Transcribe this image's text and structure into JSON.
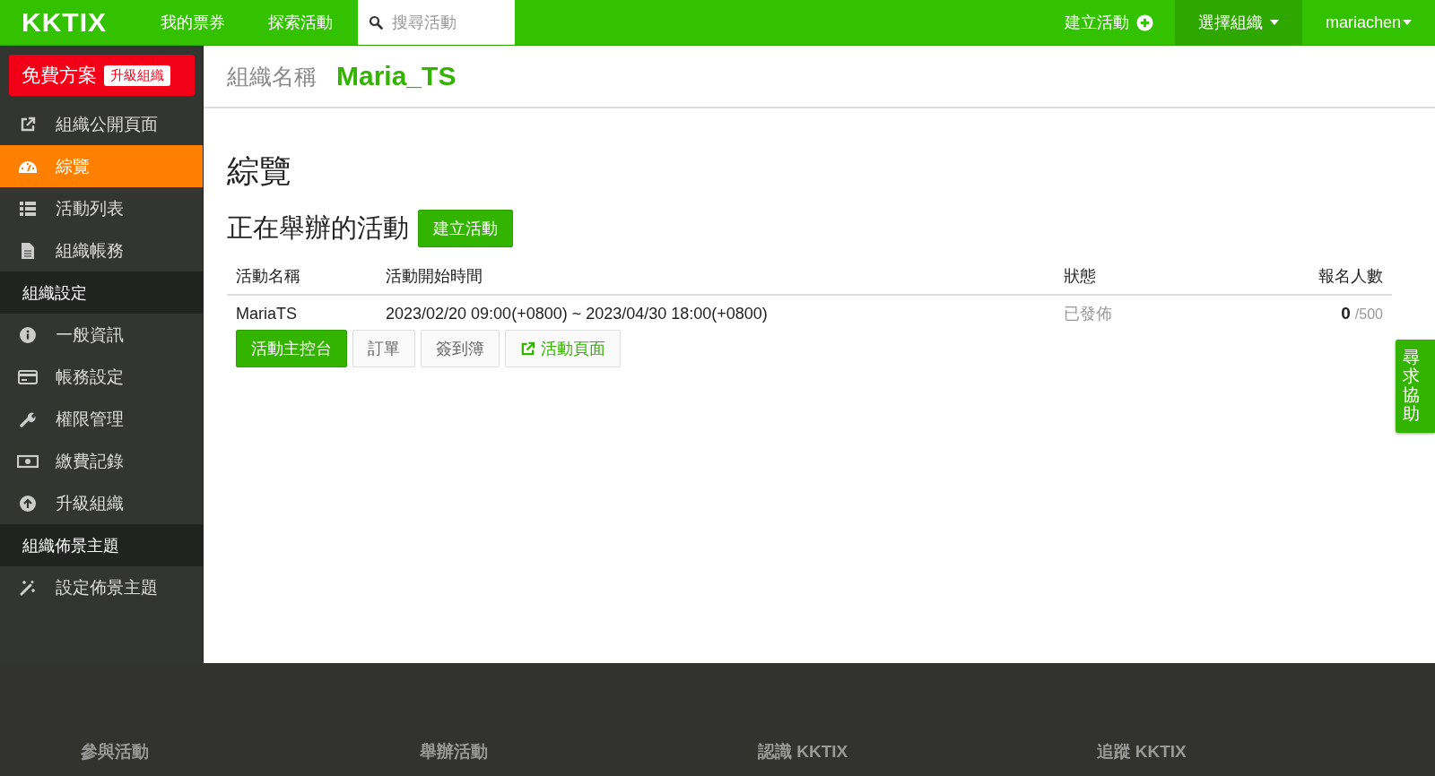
{
  "topbar": {
    "logo": "KKTIX",
    "nav": [
      "我的票券",
      "探索活動"
    ],
    "search": {
      "placeholder": "搜尋活動"
    },
    "create": "建立活動",
    "org_menu": {
      "label": "選擇組織",
      "selected": true
    },
    "user_menu": "mariachen"
  },
  "sidebar": {
    "plan": {
      "label": "免費方案",
      "badge": "升級組織"
    },
    "items": [
      {
        "kind": "link",
        "label": "組織公開頁面",
        "selected": false
      },
      {
        "kind": "link",
        "label": "綜覽",
        "selected": true
      },
      {
        "kind": "link",
        "label": "活動列表",
        "selected": false
      },
      {
        "kind": "link",
        "label": "組織帳務",
        "selected": false
      },
      {
        "kind": "header",
        "label": "組織設定"
      },
      {
        "kind": "link",
        "label": "一般資訊",
        "selected": false
      },
      {
        "kind": "link",
        "label": "帳務設定",
        "selected": false
      },
      {
        "kind": "link",
        "label": "權限管理",
        "selected": false
      },
      {
        "kind": "link",
        "label": "繳費記錄",
        "selected": false
      },
      {
        "kind": "link",
        "label": "升級組織",
        "selected": false
      },
      {
        "kind": "header",
        "label": "組織佈景主題"
      },
      {
        "kind": "link",
        "label": "設定佈景主題",
        "selected": false
      }
    ]
  },
  "org": {
    "label": "組織名稱",
    "name": "Maria_TS"
  },
  "page_title": "綜覽",
  "section": {
    "title": "正在舉辦的活動",
    "button": "建立活動"
  },
  "table": {
    "columns": [
      "活動名稱",
      "活動開始時間",
      "狀態",
      "報名人數"
    ],
    "rows": [
      {
        "name": "MariaTS",
        "time": "2023/02/20 09:00(+0800) ~ 2023/04/30 18:00(+0800)",
        "status": "已發佈",
        "registered": "0",
        "capacity": "/500",
        "actions": [
          {
            "kind": "primary",
            "label": "活動主控台"
          },
          {
            "kind": "default",
            "label": "訂單"
          },
          {
            "kind": "default",
            "label": "簽到簿"
          },
          {
            "kind": "external",
            "label": "活動頁面"
          }
        ]
      }
    ]
  },
  "help_tab": "尋求協助",
  "footer": [
    "參與活動",
    "舉辦活動",
    "認識 KKTIX",
    "追蹤 KKTIX"
  ]
}
